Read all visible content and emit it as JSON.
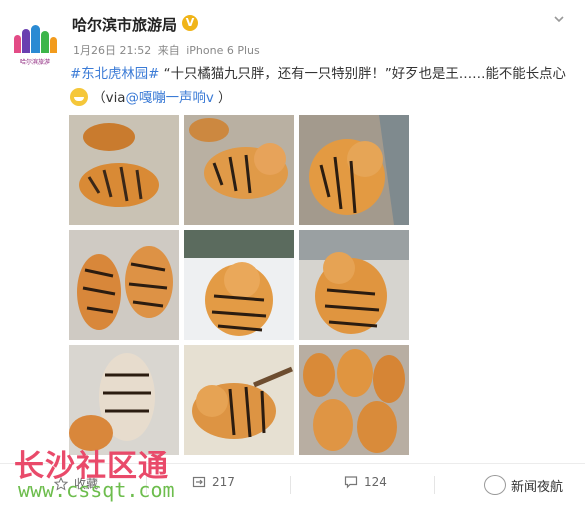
{
  "post": {
    "author": "哈尔滨市旅游局",
    "verified_badge": "V",
    "date": "1月26日 21:52",
    "via_prefix": "来自",
    "device": "iPhone 6 Plus",
    "avatar_caption": "哈尔滨旅游",
    "text": {
      "hashtag": "#东北虎林园#",
      "body": " “十只橘猫九只胖，还有一只特别胖！”好歹也是王……能不能长点心",
      "via_open": " （via",
      "mention": "@嘎嘣一声响v",
      "via_close": " ）"
    },
    "photos_count": 9
  },
  "actions": {
    "favorite_label": "收藏",
    "repost_count": "217",
    "comment_count": "124"
  },
  "watermark": {
    "cn": "长沙社区通",
    "url": "www.cssqt.com",
    "brand": "新闻夜航"
  },
  "colors": {
    "link": "#3b7bd6",
    "badge": "#f0b418",
    "watermark_cn": "#e94a6a",
    "watermark_url": "#6dbd4d"
  }
}
